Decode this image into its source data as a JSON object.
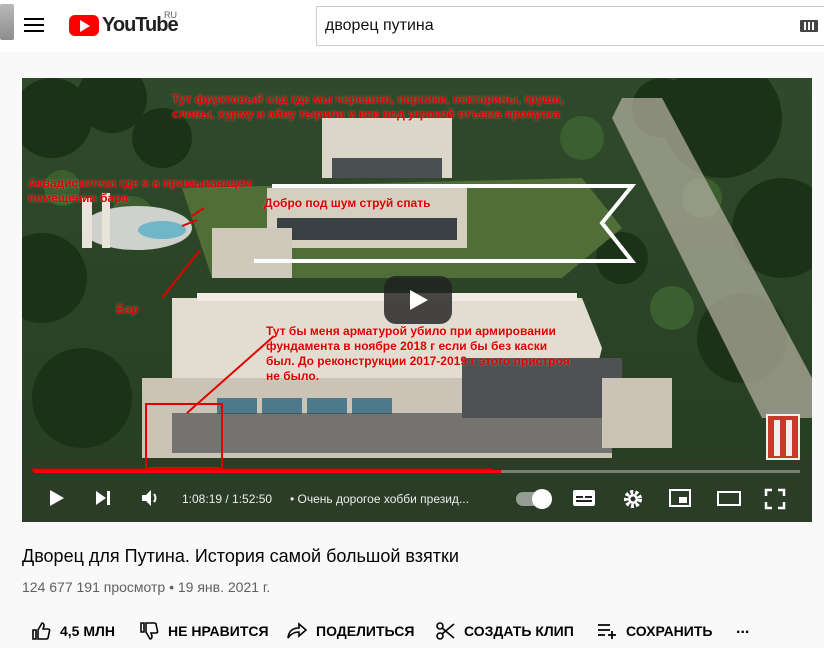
{
  "masthead": {
    "logo_text": "YouTube",
    "country_code": "RU",
    "search_value": "дворец путина",
    "icons": [
      "menu-icon",
      "youtube-logo",
      "keyboard-icon"
    ]
  },
  "player": {
    "annotations": [
      "Тут фруктовый сад где мы черешню, персики, нектарины, груши, сливы, хурму и айву тырили и все под угрозой отъема пропуска",
      "Аквадискотека где я в примыкающем помещении бара",
      "Бар",
      "Добро под шум струй спать",
      "Тут бы меня арматурой убило при армировании фундамента в ноябре 2018 г если бы без каски был. До реконструкции 2017-2019 г этого пристроя не было."
    ],
    "progress_fraction": 0.61,
    "time_display": "1:08:19 / 1:52:50",
    "chapter_title": "• Очень дорогое хобби презид...",
    "autoplay_on": true,
    "icons": [
      "play-icon",
      "next-icon",
      "volume-icon",
      "autoplay-toggle",
      "subtitles-icon",
      "settings-icon",
      "miniplayer-icon",
      "theater-icon",
      "fullscreen-icon"
    ]
  },
  "video": {
    "title": "Дворец для Путина. История самой большой взятки",
    "stats": "124 677 191 просмотр • 19 янв. 2021 г."
  },
  "actions": {
    "like": "4,5 МЛН",
    "dislike": "НЕ НРАВИТСЯ",
    "share": "ПОДЕЛИТЬСЯ",
    "clip": "СОЗДАТЬ КЛИП",
    "save": "СОХРАНИТЬ",
    "more": "..."
  },
  "colors": {
    "brand_red": "#ff0000",
    "annotation_red": "#e10000",
    "page_bg": "#f9f9f9"
  }
}
